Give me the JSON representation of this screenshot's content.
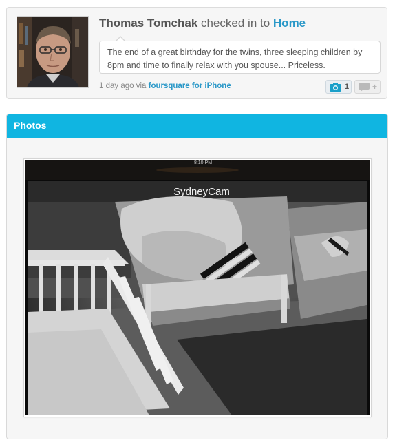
{
  "checkin": {
    "user_name": "Thomas Tomchak",
    "action": " checked in to ",
    "venue": "Home",
    "shout": "The end of a great birthday for the twins, three sleeping children by 8pm and time to finally relax with you spouse... Priceless.",
    "time_ago": "1 day ago via ",
    "via_app": "foursquare for iPhone",
    "photo_count": "1",
    "comment_plus": "+",
    "icons": {
      "photo": "camera-icon",
      "comment": "comment-bubble-icon"
    }
  },
  "photos_panel": {
    "title": "Photos",
    "camera_label": "SydneyCam",
    "clock_text": "8:10 PM"
  },
  "colors": {
    "accent": "#10b5e1",
    "link": "#2a98c8"
  }
}
